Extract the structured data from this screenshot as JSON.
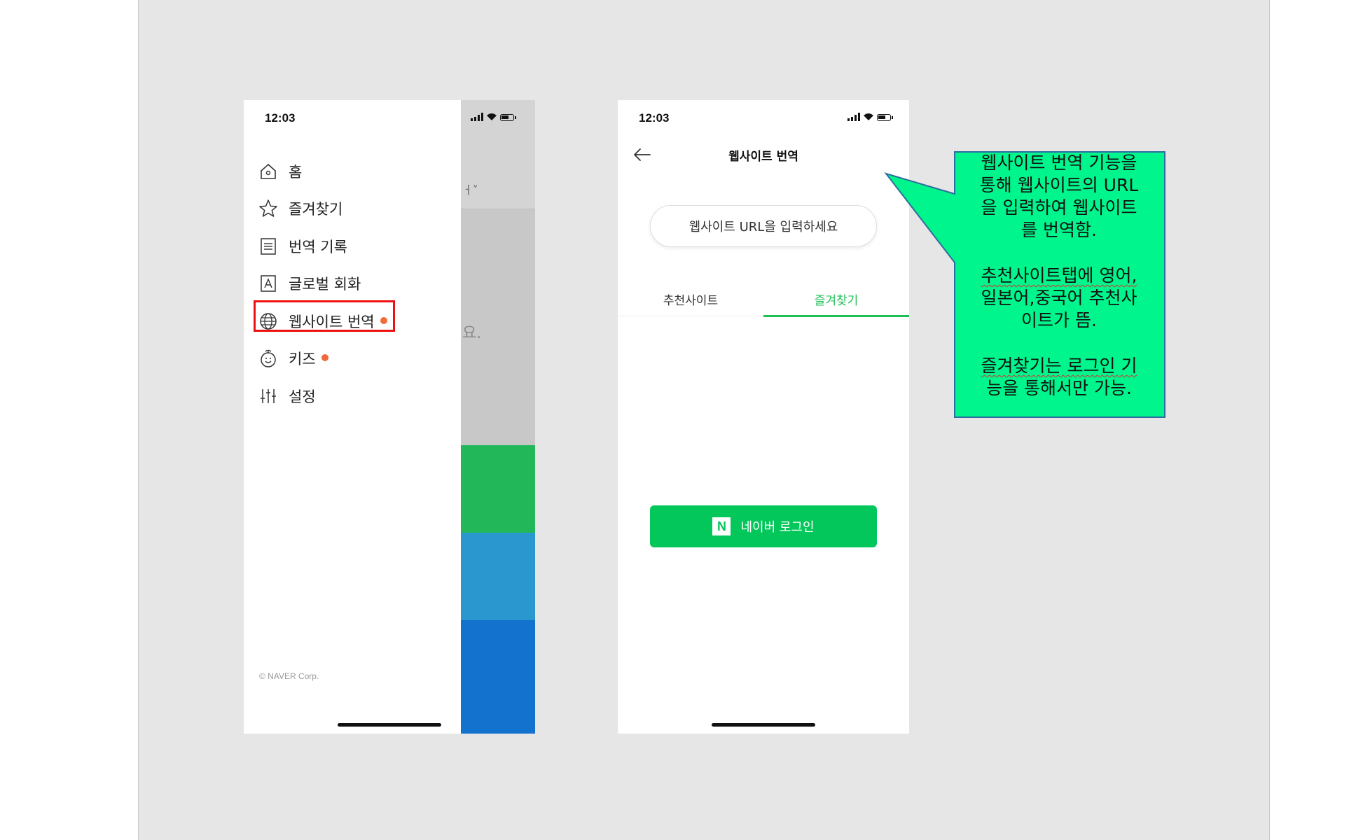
{
  "phone_left": {
    "time": "12:03",
    "menu": [
      {
        "label": "홈",
        "icon": "home-icon"
      },
      {
        "label": "즐겨찾기",
        "icon": "star-icon"
      },
      {
        "label": "번역 기록",
        "icon": "list-icon"
      },
      {
        "label": "글로벌 회화",
        "icon": "conversation-card-icon"
      },
      {
        "label": "웹사이트 번역",
        "icon": "globe-icon",
        "new_badge": true,
        "highlighted": true
      },
      {
        "label": "키즈",
        "icon": "kids-icon",
        "new_badge": true
      },
      {
        "label": "설정",
        "icon": "sliders-icon"
      }
    ],
    "copyright": "© NAVER Corp.",
    "overlay_peek_top": "ㅓ˅",
    "overlay_peek_mid": "요."
  },
  "phone_right": {
    "time": "12:03",
    "title": "웹사이트 번역",
    "url_placeholder": "웹사이트 URL을 입력하세요",
    "tabs": [
      {
        "label": "추천사이트",
        "active": false
      },
      {
        "label": "즐겨찾기",
        "active": true
      }
    ],
    "login_logo": "N",
    "login_label": "네이버 로그인"
  },
  "callout": {
    "para1_lines": [
      "웹사이트 번역 기능을",
      "통해 웹사이트의 URL",
      "을 입력하여 웹사이트",
      "를 번역함."
    ],
    "para2_lines": [
      "추천사이트탭에 영어,",
      "일본어,중국어 추천사",
      "이트가 뜸."
    ],
    "para3_lines": [
      "즐겨찾기는 로그인 기",
      "능을 통해서만 가능."
    ],
    "fill_color": "#00f58c"
  },
  "colors": {
    "brand_green": "#03c75a",
    "highlight_red": "#ee1111",
    "badge_orange": "#f06a3a"
  }
}
